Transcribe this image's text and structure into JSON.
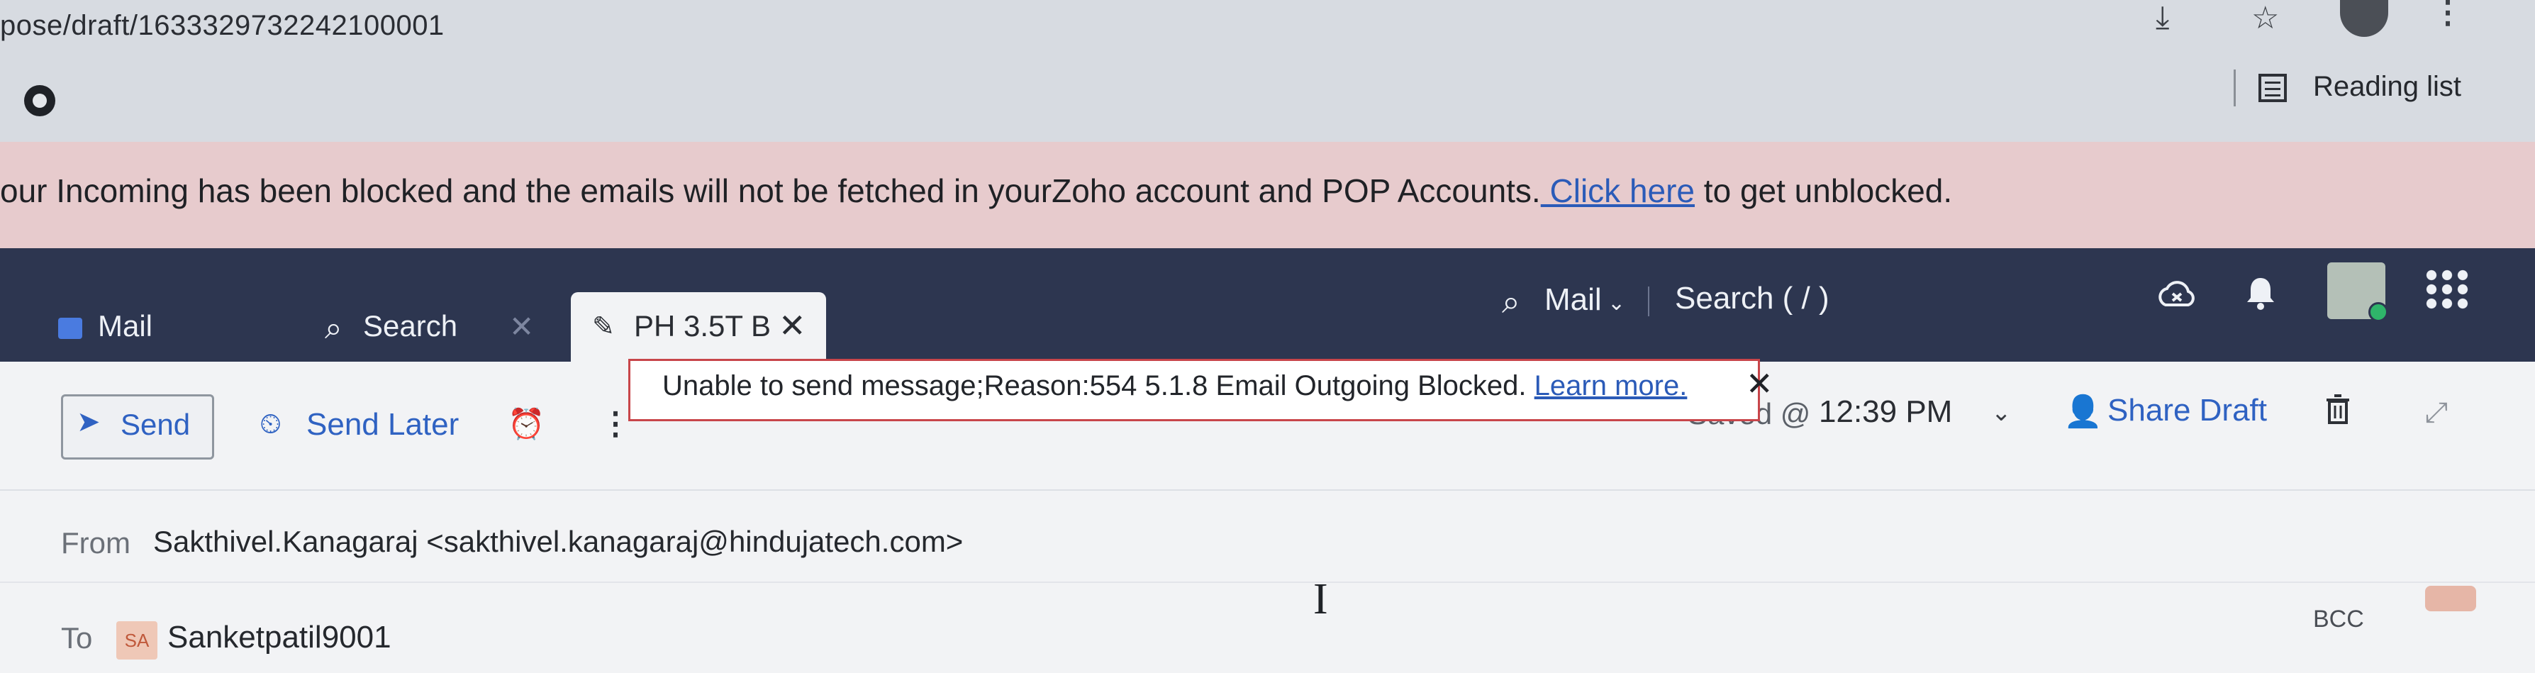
{
  "browser": {
    "url": "pose/draft/1633329732242100001",
    "reading_list_label": "Reading list",
    "icons": [
      "install-icon",
      "star-icon",
      "profile-avatar",
      "menu-icon",
      "extension-icon",
      "reading-list-icon"
    ]
  },
  "banner": {
    "text_before": "our Incoming has been blocked and the emails will not be fetched in yourZoho account and POP Accounts.",
    "link_text": " Click here",
    "text_after": " to get unblocked."
  },
  "header": {
    "tabs": [
      {
        "label": "Mail",
        "icon": "mail-icon"
      },
      {
        "label": "Search",
        "icon": "search-icon",
        "close": "✕"
      },
      {
        "label": "PH 3.5T B",
        "icon": "pencil-icon",
        "close": "✕"
      }
    ],
    "mail_dropdown": "Mail",
    "search_label": "Search ( / )",
    "accent": "#2d3650"
  },
  "toolbar": {
    "send_label": "Send",
    "send_later_label": "Send Later",
    "saved_label": "Saved @",
    "time": "12:39 PM",
    "share_label": "Share Draft"
  },
  "error": {
    "text": "Unable to send message;Reason:554 5.1.8 Email Outgoing Blocked.",
    "link": "Learn more.",
    "close": "✕",
    "border_color": "#c8454a"
  },
  "compose": {
    "from_label": "From",
    "from_value": "Sakthivel.Kanagaraj <sakthivel.kanagaraj@hindujatech.com>",
    "to_label": "To",
    "to_avatar": "SA",
    "to_value": "Sanketpatil9001",
    "bcc_label": "BCC"
  }
}
